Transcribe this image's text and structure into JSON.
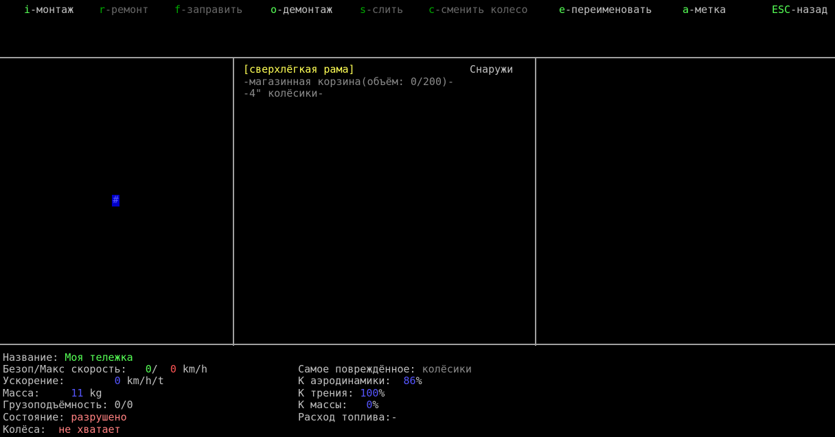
{
  "menu": [
    {
      "key": "i",
      "label": "-монтаж",
      "active": true
    },
    {
      "key": "r",
      "label": "-ремонт",
      "active": false
    },
    {
      "key": "f",
      "label": "-заправить",
      "active": false
    },
    {
      "key": "o",
      "label": "-демонтаж",
      "active": true
    },
    {
      "key": "s",
      "label": "-слить",
      "active": false
    },
    {
      "key": "c",
      "label": "-сменить колесо",
      "active": false
    },
    {
      "key": "e",
      "label": "-переименовать",
      "active": true
    },
    {
      "key": "a",
      "label": "-метка",
      "active": true
    },
    {
      "key": "ESC",
      "label": "-назад",
      "active": true
    }
  ],
  "map": {
    "cursor_glyph": "#"
  },
  "parts": {
    "location": "Снаружи",
    "frame": "[сверхлёгкая рама]",
    "items": [
      "-магазинная корзина(объём: 0/200)-",
      "-4\" колёсики-"
    ]
  },
  "stats": {
    "name_label": "Название:",
    "name_value": "Моя тележка",
    "speed_label": "Безоп/Макс скорость:",
    "speed_safe": "0",
    "speed_sep": "/",
    "speed_max": "0",
    "speed_unit": "km/h",
    "accel_label": "Ускорение:",
    "accel_value": "0",
    "accel_unit": "km/h/t",
    "mass_label": "Масса:",
    "mass_value": "11",
    "mass_unit": "kg",
    "cargo_label": "Грузоподъёмность:",
    "cargo_value": "0/0",
    "status_label": "Состояние:",
    "status_value": "разрушено",
    "wheels_label": "Колёса:",
    "wheels_value": "не хватает",
    "damaged_label": "Самое повреждённое:",
    "damaged_value": "колёсики",
    "aero_label": "К аэродинамики:",
    "aero_value": "86",
    "aero_unit": "%",
    "friction_label": "К трения:",
    "friction_value": "100",
    "friction_unit": "%",
    "massk_label": "К массы:",
    "massk_value": "0",
    "massk_unit": "%",
    "fuel_label": "Расход топлива:",
    "fuel_value": "-"
  }
}
